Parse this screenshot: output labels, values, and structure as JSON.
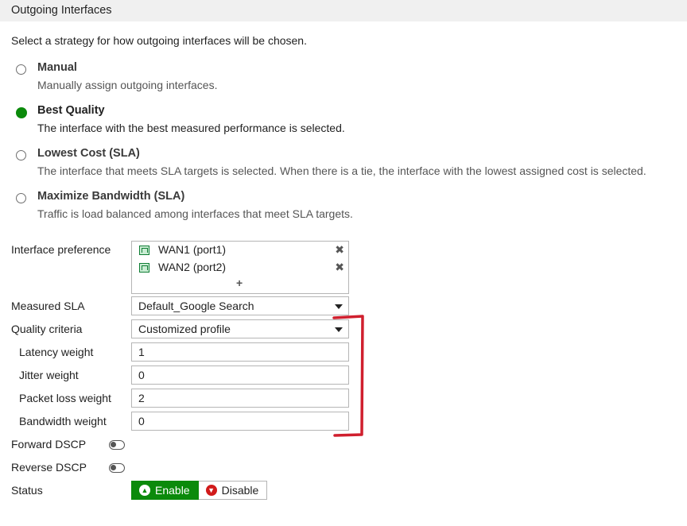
{
  "header": {
    "title": "Outgoing Interfaces"
  },
  "intro": "Select a strategy for how outgoing interfaces will be chosen.",
  "strategies": [
    {
      "title": "Manual",
      "desc": "Manually assign outgoing interfaces.",
      "selected": false
    },
    {
      "title": "Best Quality",
      "desc": "The interface with the best measured performance is selected.",
      "selected": true
    },
    {
      "title": "Lowest Cost (SLA)",
      "desc": "The interface that meets SLA targets is selected. When there is a tie, the interface with the lowest assigned cost is selected.",
      "selected": false
    },
    {
      "title": "Maximize Bandwidth (SLA)",
      "desc": "Traffic is load balanced among interfaces that meet SLA targets.",
      "selected": false
    }
  ],
  "interface_preference": {
    "label": "Interface preference",
    "items": [
      "WAN1 (port1)",
      "WAN2 (port2)"
    ],
    "remove_glyph": "✖",
    "add_glyph": "+"
  },
  "measured_sla": {
    "label": "Measured SLA",
    "value": "Default_Google Search"
  },
  "quality_criteria": {
    "label": "Quality criteria",
    "value": "Customized profile"
  },
  "weights": {
    "latency": {
      "label": "Latency weight",
      "value": "1"
    },
    "jitter": {
      "label": "Jitter weight",
      "value": "0"
    },
    "packet_loss": {
      "label": "Packet loss weight",
      "value": "2"
    },
    "bandwidth": {
      "label": "Bandwidth weight",
      "value": "0"
    }
  },
  "forward_dscp": {
    "label": "Forward DSCP"
  },
  "reverse_dscp": {
    "label": "Reverse DSCP"
  },
  "status": {
    "label": "Status",
    "enable_label": "Enable",
    "disable_label": "Disable",
    "enable_glyph": "▲",
    "disable_glyph": "▼"
  },
  "colors": {
    "selected_radio": "#0b8a0b",
    "enable_bg": "#0b8a0b",
    "disable_icon": "#d11a1a",
    "annotation": "#d01f2e"
  }
}
